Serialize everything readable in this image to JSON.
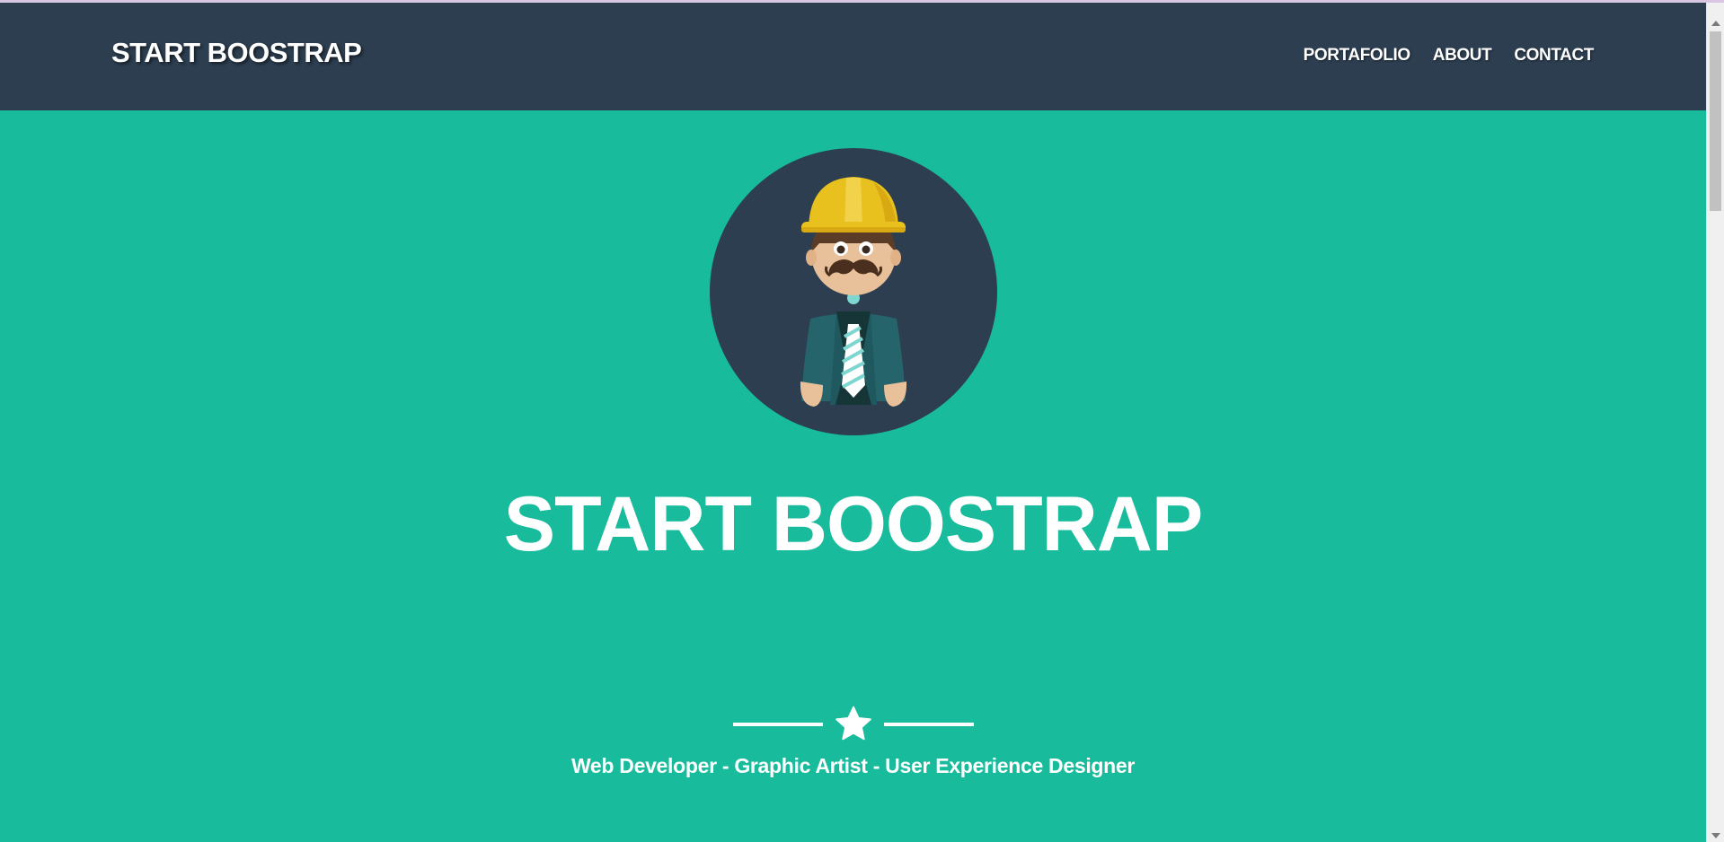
{
  "navbar": {
    "brand": "START BOOSTRAP",
    "links": [
      "PORTAFOLIO",
      "ABOUT",
      "CONTACT"
    ]
  },
  "hero": {
    "title": "START BOOSTRAP",
    "subtitle": "Web Developer - Graphic Artist - User Experience Designer",
    "avatar_icon": "construction-worker-avatar-icon",
    "divider_icon": "star-icon"
  },
  "colors": {
    "navbar": "#2c3e50",
    "hero": "#18bc9c",
    "text": "#ffffff",
    "avatar_bg": "#2c3e50",
    "helmet": "#f1c40f"
  }
}
